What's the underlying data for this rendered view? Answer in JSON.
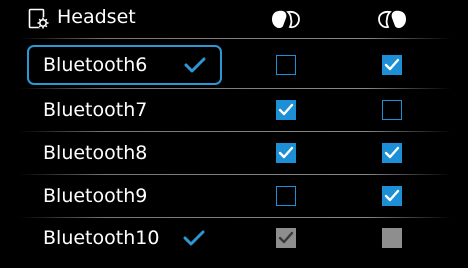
{
  "header": {
    "title": "Headset",
    "title_icon": "headset-settings-icon",
    "column_icons": [
      "left-earbud-icon",
      "right-earbud-icon"
    ]
  },
  "devices": [
    {
      "name": "Bluetooth6",
      "selected": true,
      "focused": true,
      "left": "unchecked",
      "right": "checked"
    },
    {
      "name": "Bluetooth7",
      "selected": false,
      "focused": false,
      "left": "checked",
      "right": "unchecked"
    },
    {
      "name": "Bluetooth8",
      "selected": false,
      "focused": false,
      "left": "checked",
      "right": "checked"
    },
    {
      "name": "Bluetooth9",
      "selected": false,
      "focused": false,
      "left": "unchecked",
      "right": "checked"
    },
    {
      "name": "Bluetooth10",
      "selected": true,
      "focused": false,
      "left": "disabled-checked",
      "right": "disabled-unchecked"
    }
  ],
  "colors": {
    "accent": "#1d8fd6",
    "focus_border": "#2d97d6",
    "disabled": "#8e8e8e",
    "background": "#000000",
    "text": "#ffffff"
  }
}
